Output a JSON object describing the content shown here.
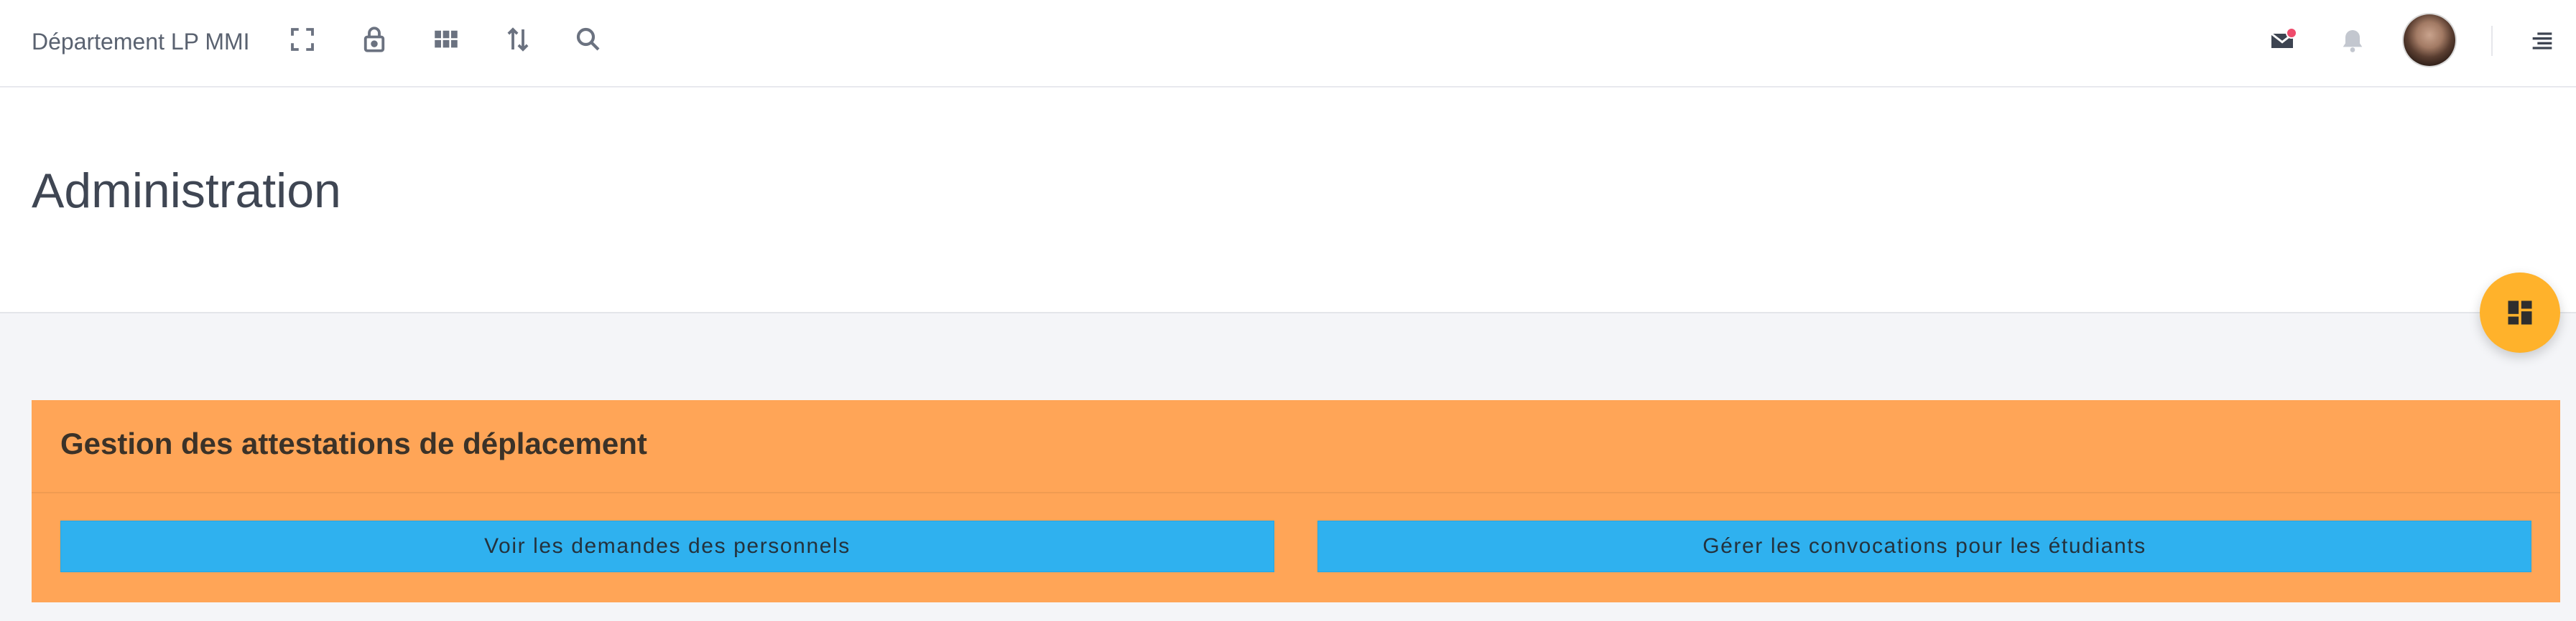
{
  "topbar": {
    "brand": "Département LP MMI",
    "icons": [
      "fullscreen-icon",
      "lock-icon",
      "apps-grid-icon",
      "sort-arrows-icon",
      "search-icon"
    ],
    "right_icons": [
      "mail-icon",
      "bell-icon",
      "avatar",
      "menu-lines-icon"
    ],
    "notification_dot_color": "#ef4b6c"
  },
  "header": {
    "title": "Administration"
  },
  "fab": {
    "icon": "dashboard-icon",
    "color": "#ffb22b"
  },
  "card": {
    "title": "Gestion des attestations de déplacement",
    "background": "#ffa557",
    "buttons": [
      {
        "label": "Voir les demandes des personnels"
      },
      {
        "label": "Gérer les convocations pour les étudiants"
      }
    ],
    "button_color": "#2fb1ef"
  }
}
